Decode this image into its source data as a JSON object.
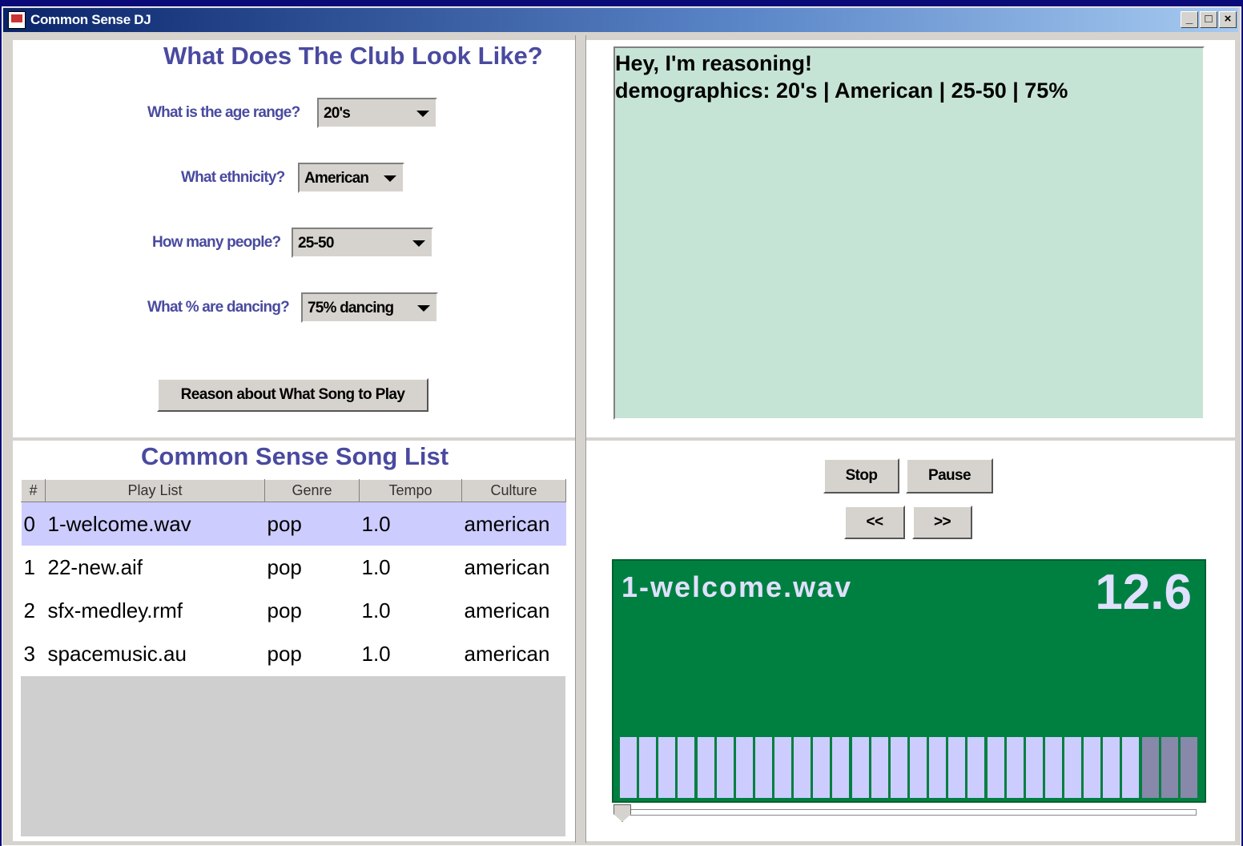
{
  "window": {
    "title": "Common Sense DJ",
    "minimize": "_",
    "maximize": "□",
    "close": "×"
  },
  "club": {
    "heading": "What Does The Club Look Like?",
    "age_label": "What is the age range?",
    "age_value": "20's",
    "ethnicity_label": "What ethnicity?",
    "ethnicity_value": "American",
    "people_label": "How many people?",
    "people_value": "25-50",
    "dancing_label": "What % are dancing?",
    "dancing_value": "75% dancing",
    "reason_button": "Reason about What Song to Play"
  },
  "output": {
    "line1": "Hey, I'm reasoning!",
    "line2": "demographics: 20's | American | 25-50 | 75%"
  },
  "songlist": {
    "heading": "Common Sense Song List",
    "columns": [
      "#",
      "Play List",
      "Genre",
      "Tempo",
      "Culture"
    ],
    "rows": [
      [
        "0",
        "1-welcome.wav",
        "pop",
        "1.0",
        "american"
      ],
      [
        "1",
        "22-new.aif",
        "pop",
        "1.0",
        "american"
      ],
      [
        "2",
        "sfx-medley.rmf",
        "pop",
        "1.0",
        "american"
      ],
      [
        "3",
        "spacemusic.au",
        "pop",
        "1.0",
        "american"
      ]
    ],
    "selected_row": 0
  },
  "controls": {
    "stop": "Stop",
    "pause": "Pause",
    "rewind": "<<",
    "forward": ">>"
  },
  "player": {
    "filename": "1-welcome.wav",
    "time": "12.6",
    "bar_count": 30,
    "lit_bars": 27,
    "seek_position": 0
  },
  "colors": {
    "heading": "#4a4aa0",
    "output_bg": "#c6e4d6",
    "player_bg": "#008040",
    "bar_lit": "#ccccff",
    "bar_dim": "#8888aa",
    "row_selected": "#ccccff"
  }
}
